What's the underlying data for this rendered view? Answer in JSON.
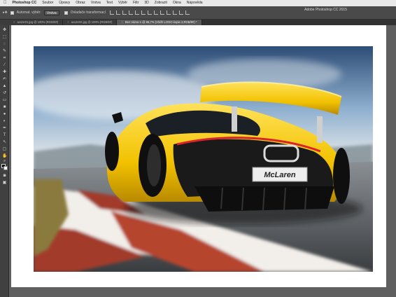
{
  "menubar": {
    "apple": "",
    "app": "Photoshop CC",
    "items": [
      "Soubor",
      "Úpravy",
      "Obraz",
      "Vrstva",
      "Text",
      "Výběr",
      "Filtr",
      "3D",
      "Zobrazit",
      "Okna",
      "Nápověda"
    ]
  },
  "options": {
    "autoselect_label": "Automat. výběr:",
    "autoselect_value": "Vrstva",
    "transform_label": "Ovladače transformací"
  },
  "app_title": "Adobe Photoshop CC 2015",
  "tabs": [
    {
      "label": "avoze01.jpg @ 100% (RGB/8#)",
      "close": "×"
    },
    {
      "label": "avoze02.jpg @ 100% (RGB/8#)",
      "close": "×"
    },
    {
      "label": "Bez názvu-1 @ 66,7% (Vložit LOGO kopie 2,RGB/8#) *",
      "close": "×"
    }
  ],
  "photo": {
    "badge_text": "McLaren"
  },
  "colors": {
    "menubar": "#e9e9e9",
    "options_bar": "#4a4a4a",
    "workspace": "#5f5f5f",
    "car_yellow": "#f2c200"
  },
  "tool_icons": [
    "move-icon",
    "marquee-icon",
    "lasso-icon",
    "quick-select-icon",
    "crop-icon",
    "eyedropper-icon",
    "healing-icon",
    "brush-icon",
    "stamp-icon",
    "history-brush-icon",
    "eraser-icon",
    "gradient-icon",
    "blur-icon",
    "dodge-icon",
    "pen-icon",
    "type-icon",
    "path-select-icon",
    "shape-icon",
    "hand-icon",
    "zoom-icon"
  ]
}
